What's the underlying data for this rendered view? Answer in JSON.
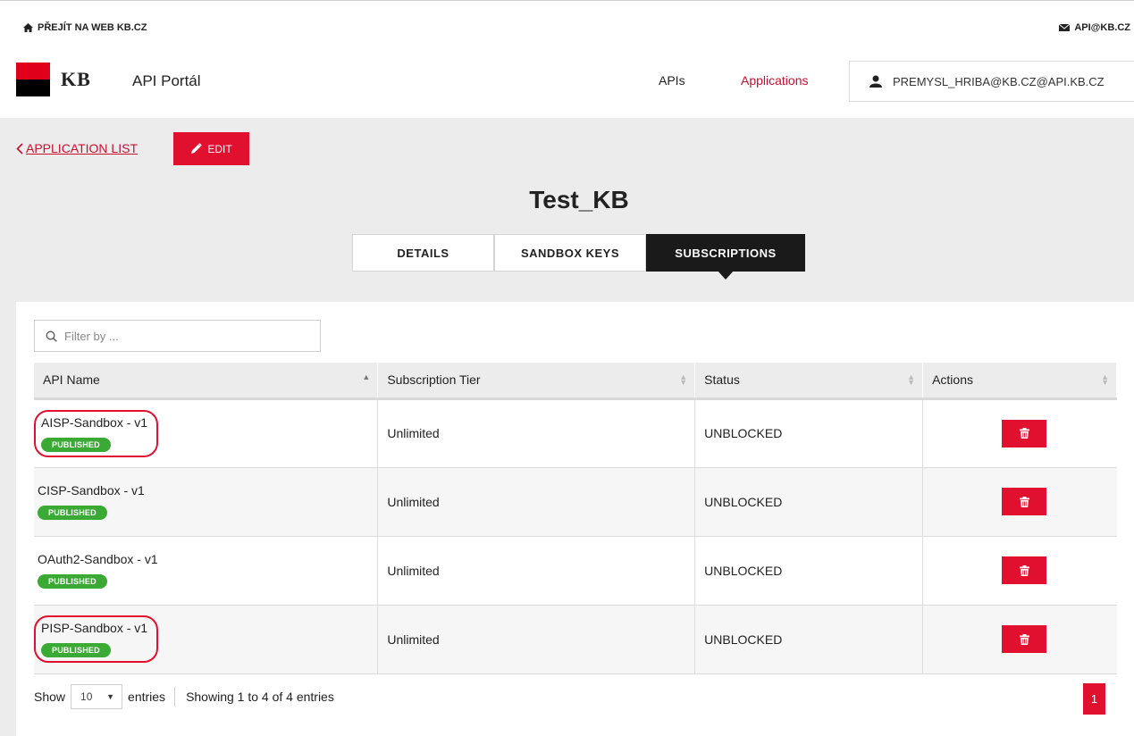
{
  "topbar": {
    "home_link": "PŘEJÍT NA WEB KB.CZ",
    "contact_email": "API@KB.CZ"
  },
  "header": {
    "logo_text": "KB",
    "portal_title": "API Portál",
    "nav": [
      {
        "label": "APIs"
      },
      {
        "label": "Applications"
      }
    ],
    "user": "PREMYSL_HRIBA@KB.CZ@API.KB.CZ"
  },
  "colors": {
    "brand_red": "#e0102e",
    "published_green": "#3aaa35"
  },
  "actions": {
    "back_label": "APPLICATION LIST",
    "edit_label": "EDIT"
  },
  "app": {
    "title": "Test_KB"
  },
  "tabs": [
    {
      "label": "DETAILS"
    },
    {
      "label": "SANDBOX KEYS"
    },
    {
      "label": "SUBSCRIPTIONS"
    }
  ],
  "filter": {
    "placeholder": "Filter by ..."
  },
  "table": {
    "headers": [
      "API Name",
      "Subscription Tier",
      "Status",
      "Actions"
    ],
    "rows": [
      {
        "name": "AISP-Sandbox - v1",
        "badge": "PUBLISHED",
        "tier": "Unlimited",
        "status": "UNBLOCKED"
      },
      {
        "name": "CISP-Sandbox - v1",
        "badge": "PUBLISHED",
        "tier": "Unlimited",
        "status": "UNBLOCKED"
      },
      {
        "name": "OAuth2-Sandbox - v1",
        "badge": "PUBLISHED",
        "tier": "Unlimited",
        "status": "UNBLOCKED"
      },
      {
        "name": "PISP-Sandbox - v1",
        "badge": "PUBLISHED",
        "tier": "Unlimited",
        "status": "UNBLOCKED"
      }
    ]
  },
  "footer": {
    "show_label": "Show",
    "page_length": "10",
    "entries_label": "entries",
    "info": "Showing 1 to 4 of 4 entries",
    "current_page": "1"
  }
}
